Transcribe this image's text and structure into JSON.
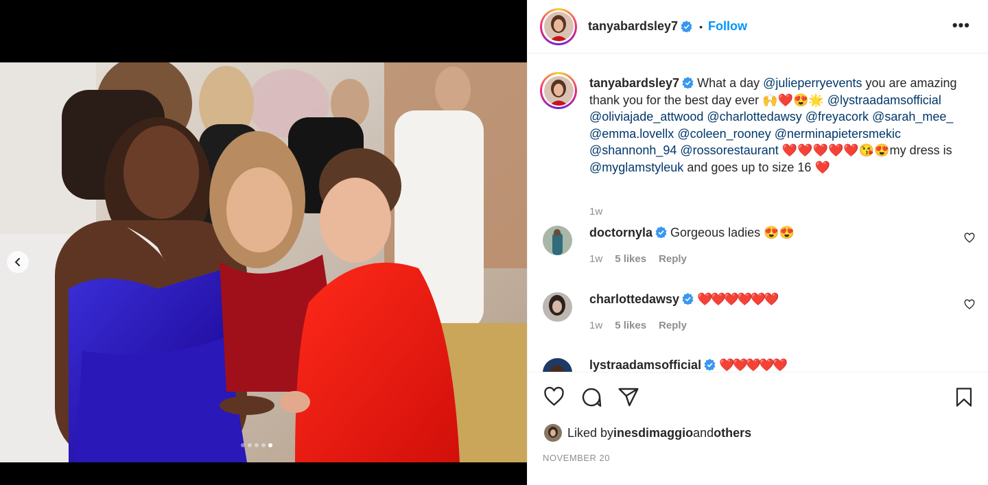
{
  "post": {
    "username": "tanyabardsley7",
    "follow_label": "Follow",
    "separator": "•",
    "more_label": "•••",
    "carousel": {
      "slide_count": 5,
      "active_index": 4
    }
  },
  "caption": {
    "username": "tanyabardsley7",
    "t1": "What a day ",
    "m1": "@julieperryevents",
    "t2": " you are amazing thank you for the best day ever 🙌❤️😍🌟 ",
    "m2": "@lystraadamsofficial",
    "m3": "@oliviajade_attwood",
    "m4": "@charlottedawsy",
    "m5": "@freyacork",
    "m6": "@sarah_mee_",
    "m7": "@emma.lovellx",
    "m8": "@coleen_rooney",
    "m9": "@nerminapietersmekic",
    "m10": "@shannonh_94",
    "m11": "@rossorestaurant",
    "t3": " ❤️❤️❤️❤️❤️😘😍my dress is ",
    "m12": "@myglamstyleuk",
    "t4": " and goes up to size 16 ❤️",
    "time": "1w"
  },
  "comments": [
    {
      "username": "doctornyla",
      "text": "Gorgeous ladies 😍😍",
      "time": "1w",
      "likes": "5 likes",
      "reply": "Reply"
    },
    {
      "username": "charlottedawsy",
      "text": "❤️❤️❤️❤️❤️❤️",
      "time": "1w",
      "likes": "5 likes",
      "reply": "Reply"
    },
    {
      "username": "lystraadamsofficial",
      "text": "❤️❤️❤️❤️❤️",
      "time": "",
      "likes": "",
      "reply": ""
    }
  ],
  "liked_by": {
    "prefix": "Liked by ",
    "user": "inesdimaggio",
    "middle": " and ",
    "others": "others"
  },
  "date": "NOVEMBER 20",
  "icons": [
    "chevron-left-icon",
    "heart-icon",
    "comment-icon",
    "share-icon",
    "bookmark-icon",
    "verified-icon",
    "more-icon"
  ],
  "colors": {
    "follow": "#0095f6",
    "mention": "#00376b",
    "muted": "#8e8e8e",
    "verified": "#3897f0"
  }
}
